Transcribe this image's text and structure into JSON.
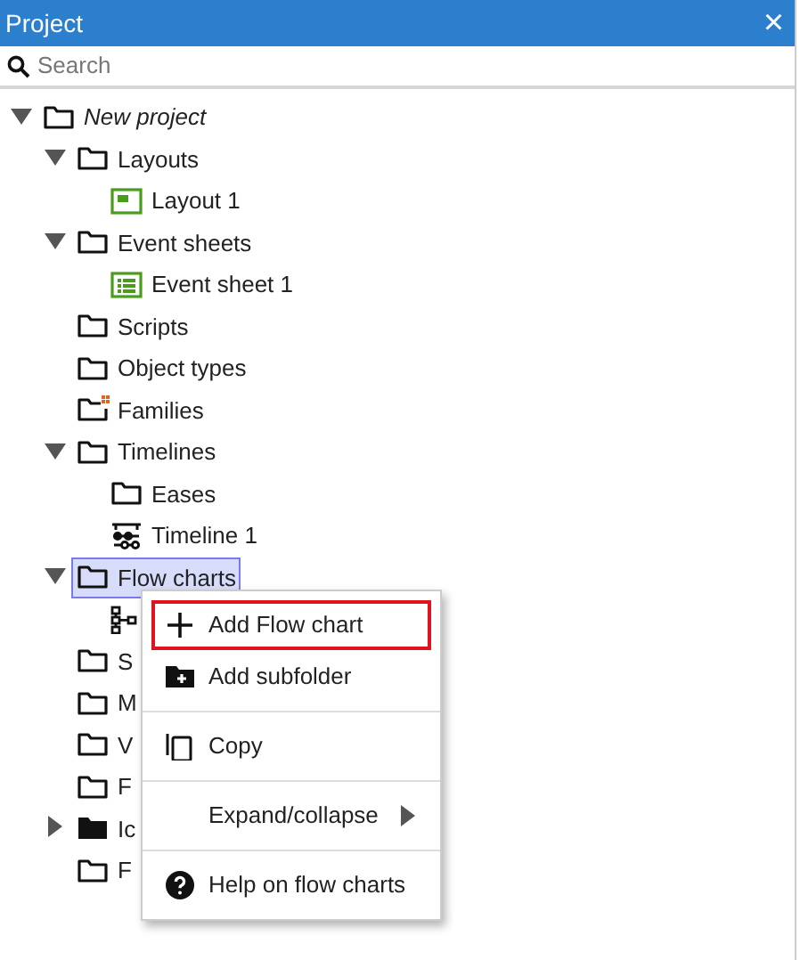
{
  "panel": {
    "title": "Project",
    "close": "×"
  },
  "search": {
    "placeholder": "Search"
  },
  "tree": [
    {
      "label": "New project",
      "kind": "project",
      "expanded": true,
      "selected": false,
      "children": [
        {
          "label": "Layouts",
          "kind": "folder",
          "expanded": true,
          "selected": false,
          "children": [
            {
              "label": "Layout 1",
              "kind": "layout",
              "selected": false
            }
          ]
        },
        {
          "label": "Event sheets",
          "kind": "folder",
          "expanded": true,
          "selected": false,
          "children": [
            {
              "label": "Event sheet 1",
              "kind": "event-sheet",
              "selected": false
            }
          ]
        },
        {
          "label": "Scripts",
          "kind": "folder",
          "selected": false
        },
        {
          "label": "Object types",
          "kind": "folder",
          "selected": false
        },
        {
          "label": "Families",
          "kind": "family-folder",
          "selected": false
        },
        {
          "label": "Timelines",
          "kind": "folder",
          "expanded": true,
          "selected": false,
          "children": [
            {
              "label": "Eases",
              "kind": "folder",
              "selected": false
            },
            {
              "label": "Timeline 1",
              "kind": "timeline",
              "selected": false
            }
          ]
        },
        {
          "label": "Flow charts",
          "kind": "folder",
          "expanded": true,
          "selected": true,
          "children": [
            {
              "kind": "flowchart",
              "selected": false
            }
          ]
        },
        {
          "label": "S",
          "kind": "folder",
          "selected": false
        },
        {
          "label": "M",
          "kind": "folder",
          "selected": false
        },
        {
          "label": "V",
          "kind": "folder",
          "selected": false
        },
        {
          "label": "F",
          "kind": "folder",
          "selected": false
        },
        {
          "label": "Ic",
          "kind": "folder",
          "expanded": false,
          "selected": false
        },
        {
          "label": "F",
          "kind": "folder",
          "selected": false
        }
      ]
    }
  ],
  "context_menu": {
    "groups": [
      [
        {
          "label": "Add Flow chart",
          "kind": "add-item",
          "focused": true
        },
        {
          "label": "Add subfolder",
          "kind": "add-folder",
          "focused": false
        }
      ],
      [
        {
          "label": "Copy",
          "kind": "copy",
          "focused": false
        }
      ],
      [
        {
          "label": "Expand/collapse",
          "kind": "submenu",
          "focused": false
        }
      ],
      [
        {
          "label": "Help on flow charts",
          "kind": "help",
          "focused": false
        }
      ]
    ]
  }
}
